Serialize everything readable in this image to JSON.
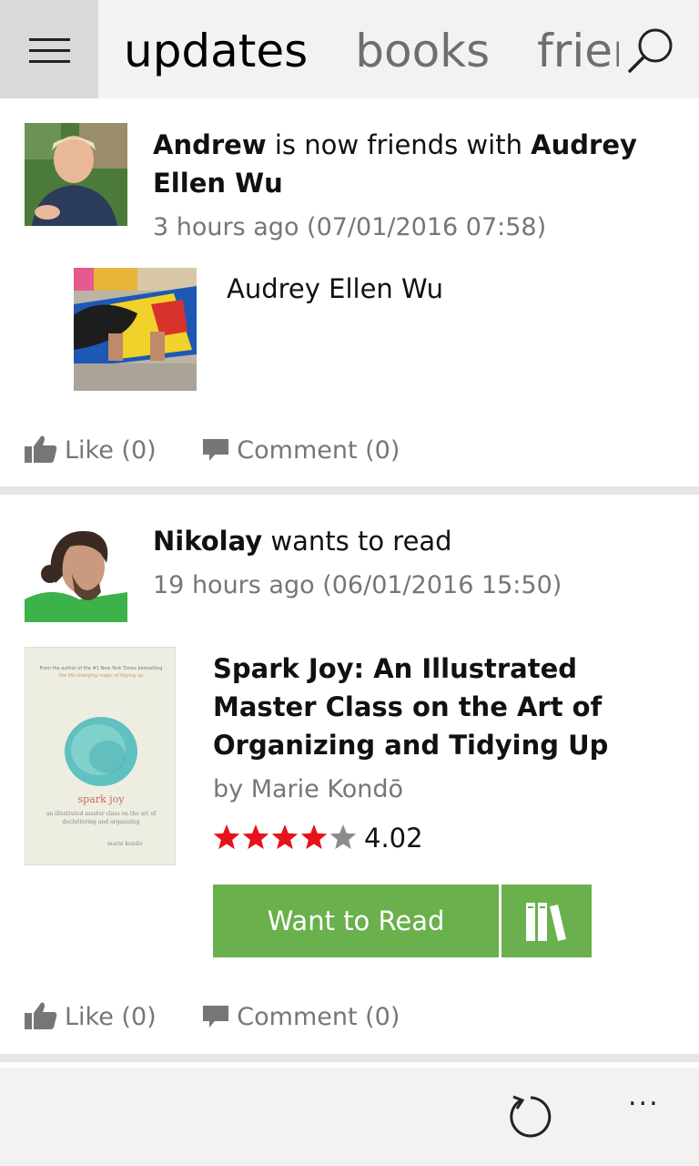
{
  "header": {
    "tabs": [
      {
        "label": "updates",
        "active": true
      },
      {
        "label": "books",
        "active": false
      },
      {
        "label": "frier",
        "active": false
      }
    ],
    "icons": {
      "menu": "hamburger-icon",
      "search": "search-icon"
    }
  },
  "feed": [
    {
      "actor": "Andrew",
      "verb": " is now friends with ",
      "target": "Audrey Ellen Wu",
      "time": "3 hours ago (07/01/2016 07:58)",
      "friend_name": "Audrey Ellen Wu",
      "like_label": "Like (0)",
      "comment_label": "Comment (0)"
    },
    {
      "actor": "Nikolay",
      "verb": " wants to read",
      "time": "19 hours ago (06/01/2016 15:50)",
      "book": {
        "title": "Spark Joy: An Illustrated Master Class on the Art of Organizing and Tidying Up",
        "author": "by Marie Kondō",
        "rating": 4.02,
        "rating_label": "4.02",
        "cover": {
          "tagline1": "From the author of the #1 New York Times bestselling",
          "tagline2": "the life-changing magic of tidying up",
          "title": "spark joy",
          "subtitle": "an illustrated master class on the art of decluttering and organizing",
          "author": "marie kondo"
        }
      },
      "want_label": "Want to Read",
      "like_label": "Like (0)",
      "comment_label": "Comment (0)"
    }
  ],
  "appbar": {
    "more_label": "..."
  },
  "colors": {
    "accent_green": "#6ab04c",
    "star_red": "#e8121a",
    "star_grey": "#8c8c8c",
    "header_bg": "#f2f2f2"
  }
}
